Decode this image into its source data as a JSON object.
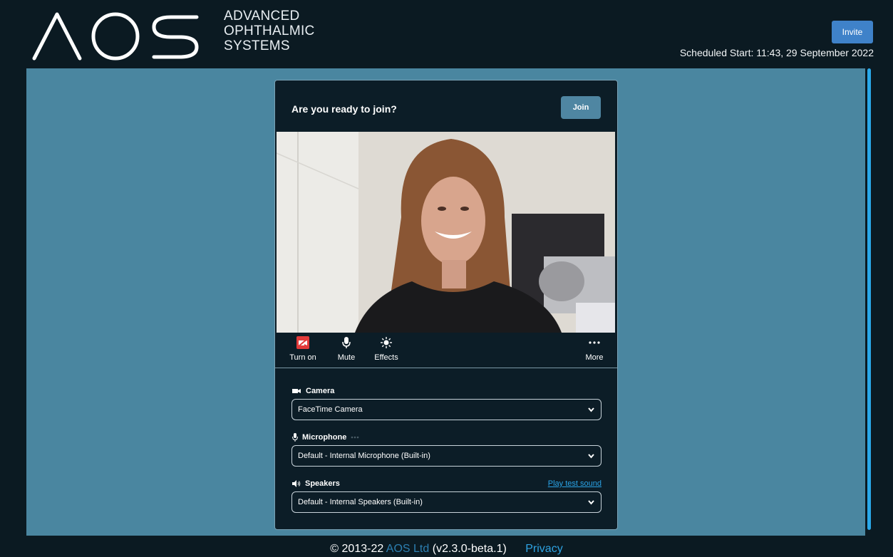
{
  "header": {
    "logo_text": "AOS",
    "brand_lines": [
      "ADVANCED",
      "OPHTHALMIC",
      "SYSTEMS"
    ],
    "invite_label": "Invite",
    "scheduled_start": "Scheduled Start: 11:43, 29 September 2022"
  },
  "join_panel": {
    "title": "Are you ready to join?",
    "join_label": "Join",
    "controls": {
      "camera_label": "Turn on",
      "mute_label": "Mute",
      "effects_label": "Effects",
      "more_label": "More"
    },
    "camera": {
      "label": "Camera",
      "value": "FaceTime Camera"
    },
    "microphone": {
      "label": "Microphone",
      "value": "Default - Internal Microphone (Built-in)"
    },
    "speakers": {
      "label": "Speakers",
      "test_link": "Play test sound",
      "value": "Default - Internal Speakers (Built-in)"
    }
  },
  "footer": {
    "copyright": "© 2013-22",
    "company": "AOS Ltd",
    "version": "(v2.3.0-beta.1)",
    "privacy": "Privacy"
  },
  "colors": {
    "background": "#0b1a22",
    "stage": "#4a86a0",
    "accent_blue": "#3f82c9",
    "link_blue": "#2aa3e6",
    "camera_off_red": "#e23a3a"
  },
  "icons": [
    "camera-off-icon",
    "microphone-icon",
    "effects-icon",
    "more-icon",
    "video-camera-icon",
    "speaker-icon",
    "chevron-down-icon"
  ]
}
